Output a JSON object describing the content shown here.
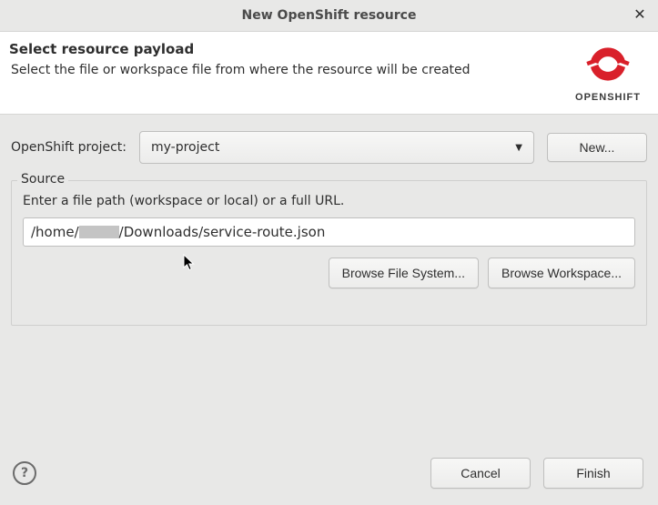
{
  "title": "New OpenShift resource",
  "banner": {
    "heading": "Select resource payload",
    "subtitle": "Select the file or workspace file from where the resource will be created"
  },
  "logo": {
    "label": "OPENSHIFT"
  },
  "project": {
    "label": "OpenShift project:",
    "selected": "my-project",
    "new_label": "New..."
  },
  "source": {
    "legend": "Source",
    "hint": "Enter a file path (workspace or local) or a full URL.",
    "path_prefix": "/home/",
    "path_suffix": "/Downloads/service-route.json",
    "browse_fs_label": "Browse File System...",
    "browse_ws_label": "Browse Workspace..."
  },
  "footer": {
    "cancel_label": "Cancel",
    "finish_label": "Finish"
  }
}
